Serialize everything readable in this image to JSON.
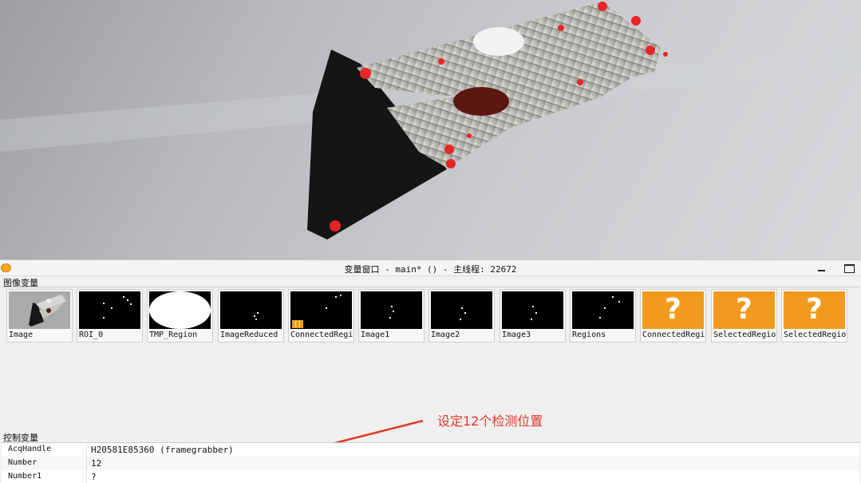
{
  "window": {
    "title": "变量窗口 - main* () - 主线程: 22672"
  },
  "image_variables": {
    "section_label": "图像变量",
    "items": [
      {
        "label": "Image",
        "kind": "photo"
      },
      {
        "label": "ROI_0",
        "kind": "region"
      },
      {
        "label": "TMP_Region",
        "kind": "disk"
      },
      {
        "label": "ImageReduced",
        "kind": "region"
      },
      {
        "label": "ConnectedRegions",
        "kind": "region",
        "badge": "[]"
      },
      {
        "label": "Image1",
        "kind": "region"
      },
      {
        "label": "Image2",
        "kind": "region"
      },
      {
        "label": "Image3",
        "kind": "region"
      },
      {
        "label": "Regions",
        "kind": "region"
      },
      {
        "label": "ConnectedRegions",
        "kind": "unknown",
        "icon": "?"
      },
      {
        "label": "SelectedRegions",
        "kind": "unknown",
        "icon": "?"
      },
      {
        "label": "SelectedRegions",
        "kind": "unknown",
        "icon": "?"
      }
    ]
  },
  "annotation": {
    "text": "设定12个检测位置",
    "color": "#e0392b"
  },
  "control_variables": {
    "section_label": "控制变量",
    "rows": [
      {
        "name": "AcqHandle",
        "value": "H20581E85360 (framegrabber)"
      },
      {
        "name": "Number",
        "value": "12"
      },
      {
        "name": "Number1",
        "value": "?"
      }
    ]
  },
  "colors": {
    "accent_unknown": "#f29a1e",
    "marker_red": "#e8262a"
  }
}
